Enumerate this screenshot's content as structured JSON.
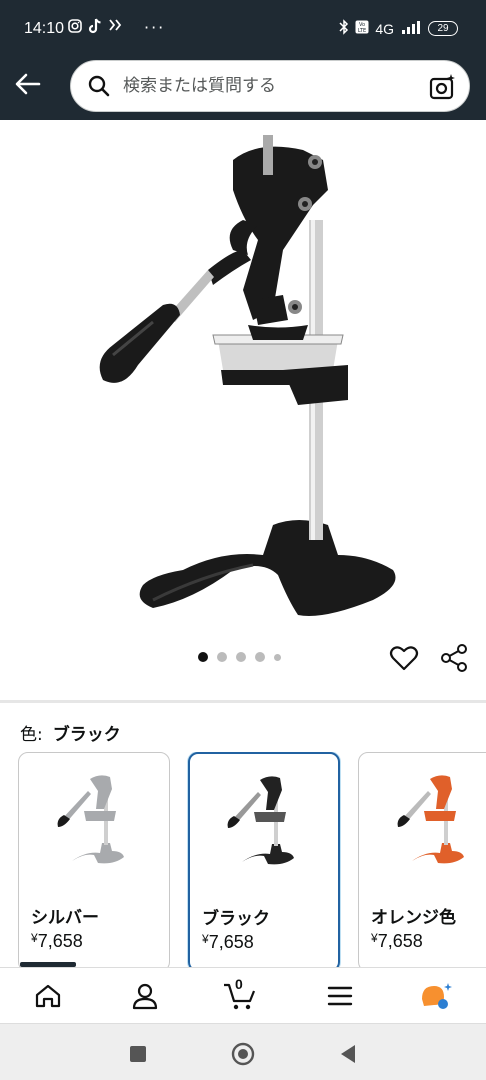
{
  "status_bar": {
    "time": "14:10",
    "dots": "···",
    "network": "4G",
    "battery": "29"
  },
  "header": {
    "search_placeholder": "検索または質問する"
  },
  "carousel": {
    "total": 5,
    "active_index": 0
  },
  "color_selector": {
    "label": "色:",
    "selected": "ブラック"
  },
  "variants": [
    {
      "name": "シルバー",
      "currency": "¥",
      "price": "7,658",
      "color": "#a8aaad",
      "selected": false
    },
    {
      "name": "ブラック",
      "currency": "¥",
      "price": "7,658",
      "color": "#222222",
      "selected": true
    },
    {
      "name": "オレンジ色",
      "currency": "¥",
      "price": "7,658",
      "color": "#e0602a",
      "selected": false
    }
  ],
  "bottom_nav": {
    "cart_count": "0",
    "items": [
      "home-icon",
      "account-icon",
      "cart-icon",
      "menu-icon",
      "rufus-icon"
    ]
  },
  "colors": {
    "header_bg": "#1f2a33",
    "selected_border": "#2162a1",
    "rufus_orange": "#f7902f",
    "rufus_blue": "#2d7fd2"
  }
}
